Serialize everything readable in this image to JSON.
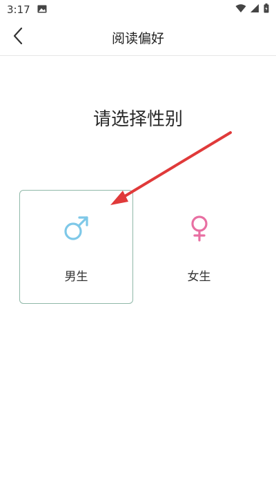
{
  "status_bar": {
    "time": "3:17",
    "icons": [
      "image-icon",
      "wifi-icon",
      "signal-icon",
      "battery-icon"
    ]
  },
  "app_bar": {
    "title": "阅读偏好",
    "back_icon": "back-arrow-icon"
  },
  "main": {
    "prompt": "请选择性别",
    "options": [
      {
        "label": "男生",
        "icon": "male-symbol-icon",
        "selected": true,
        "color": "#7ec8e8"
      },
      {
        "label": "女生",
        "icon": "female-symbol-icon",
        "selected": false,
        "color": "#e86fa2"
      }
    ]
  },
  "annotation": {
    "arrow_color": "#e03a3a"
  }
}
